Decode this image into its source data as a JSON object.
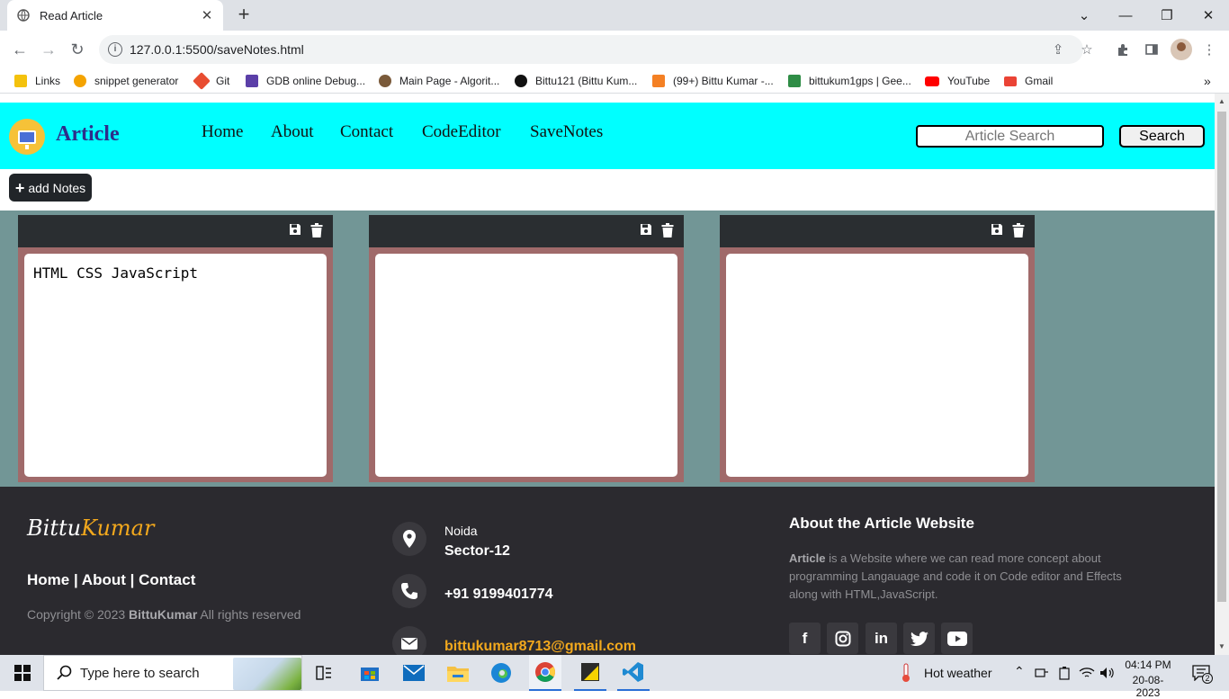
{
  "browser": {
    "tab_title": "Read Article",
    "url": "127.0.0.1:5500/saveNotes.html",
    "bookmarks": [
      {
        "label": "Links",
        "color": "#f4c20d"
      },
      {
        "label": "snippet generator",
        "color": "#f4a300"
      },
      {
        "label": "Git",
        "color": "#e84d31"
      },
      {
        "label": "GDB online Debug...",
        "color": "#5b3fa8"
      },
      {
        "label": "Main Page - Algorit...",
        "color": "#7a5a3a"
      },
      {
        "label": "Bittu121 (Bittu Kum...",
        "color": "#111111"
      },
      {
        "label": "(99+) Bittu Kumar -...",
        "color": "#f48024"
      },
      {
        "label": "bittukum1gps | Gee...",
        "color": "#2f8d46"
      },
      {
        "label": "YouTube",
        "color": "#ff0000"
      },
      {
        "label": "Gmail",
        "color": "#ea4335"
      }
    ]
  },
  "site": {
    "brand": "Article",
    "nav": [
      "Home",
      "About",
      "Contact",
      "CodeEditor",
      "SaveNotes"
    ],
    "search_placeholder": "Article Search",
    "search_button": "Search",
    "add_notes_label": "add Notes",
    "notes": [
      {
        "text": "HTML CSS JavaScript"
      },
      {
        "text": ""
      },
      {
        "text": ""
      }
    ]
  },
  "footer": {
    "logo_part1": "Bittu",
    "logo_part2": "Kumar",
    "links": "Home | About | Contact",
    "copyright_prefix": "Copyright © 2023",
    "copyright_name": "BittuKumar",
    "copyright_suffix": "All rights reserved",
    "city": "Noida",
    "sector": "Sector-12",
    "phone": "+91 9199401774",
    "email": "bittukumar8713@gmail.com",
    "about_title": "About the Article Website",
    "about_bold": "Article",
    "about_text": " is a Website where we can read more concept about programming Langauage and code it on Code editor and Effects along with HTML,JavaScript.",
    "social": [
      "facebook",
      "instagram",
      "linkedin",
      "twitter",
      "youtube"
    ]
  },
  "taskbar": {
    "search_placeholder": "Type here to search",
    "weather": "Hot weather",
    "time": "04:14 PM",
    "date": "20-08-2023",
    "notification_count": "2"
  },
  "colors": {
    "nav_bg": "#00ffff",
    "notes_bg": "#729696",
    "note_frame": "#a06a6a",
    "footer_bg": "#2b2a2f",
    "accent": "#f2a81d"
  }
}
